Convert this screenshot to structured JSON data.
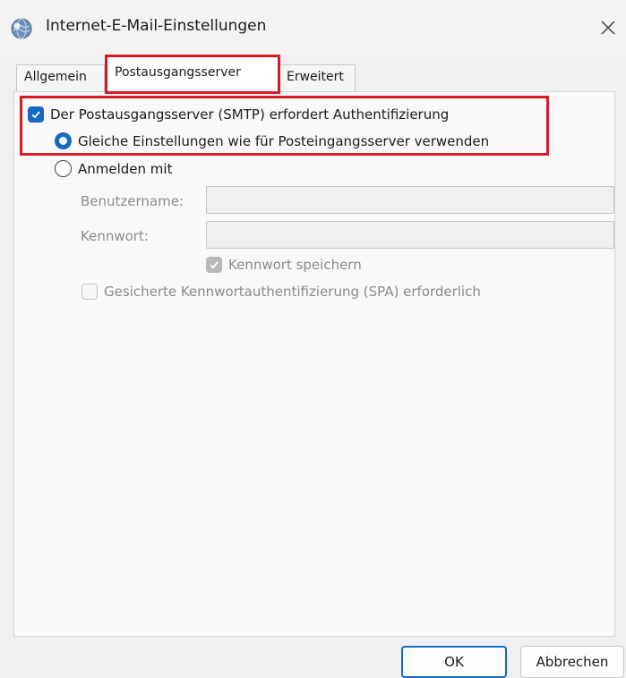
{
  "window": {
    "title": "Internet-E-Mail-Einstellungen",
    "app_icon": "mail-globe-icon",
    "close_icon": "close-icon"
  },
  "tabs": [
    {
      "label": "Allgemein",
      "active": false
    },
    {
      "label": "Postausgangsserver",
      "active": true
    },
    {
      "label": "Erweitert",
      "active": false
    }
  ],
  "outgoing": {
    "smtp_auth": {
      "label": "Der Postausgangsserver (SMTP) erfordert Authentifizierung",
      "checked": true
    },
    "same_settings": {
      "label": "Gleiche Einstellungen wie für Posteingangsserver verwenden",
      "selected": true
    },
    "login_with": {
      "label": "Anmelden mit",
      "selected": false
    },
    "username": {
      "label": "Benutzername:",
      "value": ""
    },
    "password": {
      "label": "Kennwort:",
      "value": ""
    },
    "save_password": {
      "label": "Kennwort speichern",
      "checked": true,
      "disabled": true
    },
    "spa": {
      "label": "Gesicherte Kennwortauthentifizierung (SPA) erforderlich",
      "checked": false,
      "disabled": true
    }
  },
  "buttons": {
    "ok": "OK",
    "cancel": "Abbrechen"
  },
  "colors": {
    "accent": "#1668c5",
    "highlight": "#d91a26"
  }
}
